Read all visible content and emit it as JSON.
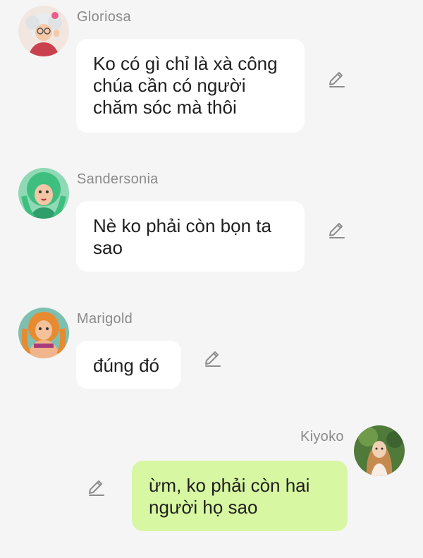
{
  "messages": [
    {
      "sender": "Gloriosa",
      "text": "Ko có gì chỉ là xà công\nchúa cần có người\nchăm sóc mà thôi",
      "avatar_icon": "gloriosa-avatar"
    },
    {
      "sender": "Sandersonia",
      "text": "Nè ko phải còn bọn ta\nsao",
      "avatar_icon": "sandersonia-avatar"
    },
    {
      "sender": "Marigold",
      "text": "đúng đó",
      "avatar_icon": "marigold-avatar"
    },
    {
      "sender": "Kiyoko",
      "text": "ừm, ko phải còn hai\nngười họ sao",
      "avatar_icon": "kiyoko-avatar"
    }
  ],
  "icons": {
    "edit": "edit-pencil-icon"
  },
  "colors": {
    "background": "#f5f5f5",
    "incoming_bubble": "#ffffff",
    "outgoing_bubble": "#d7f7a2",
    "sender_name": "#8a8a8a",
    "message_text": "#1f1f1f",
    "icon": "#8d8d8d"
  }
}
